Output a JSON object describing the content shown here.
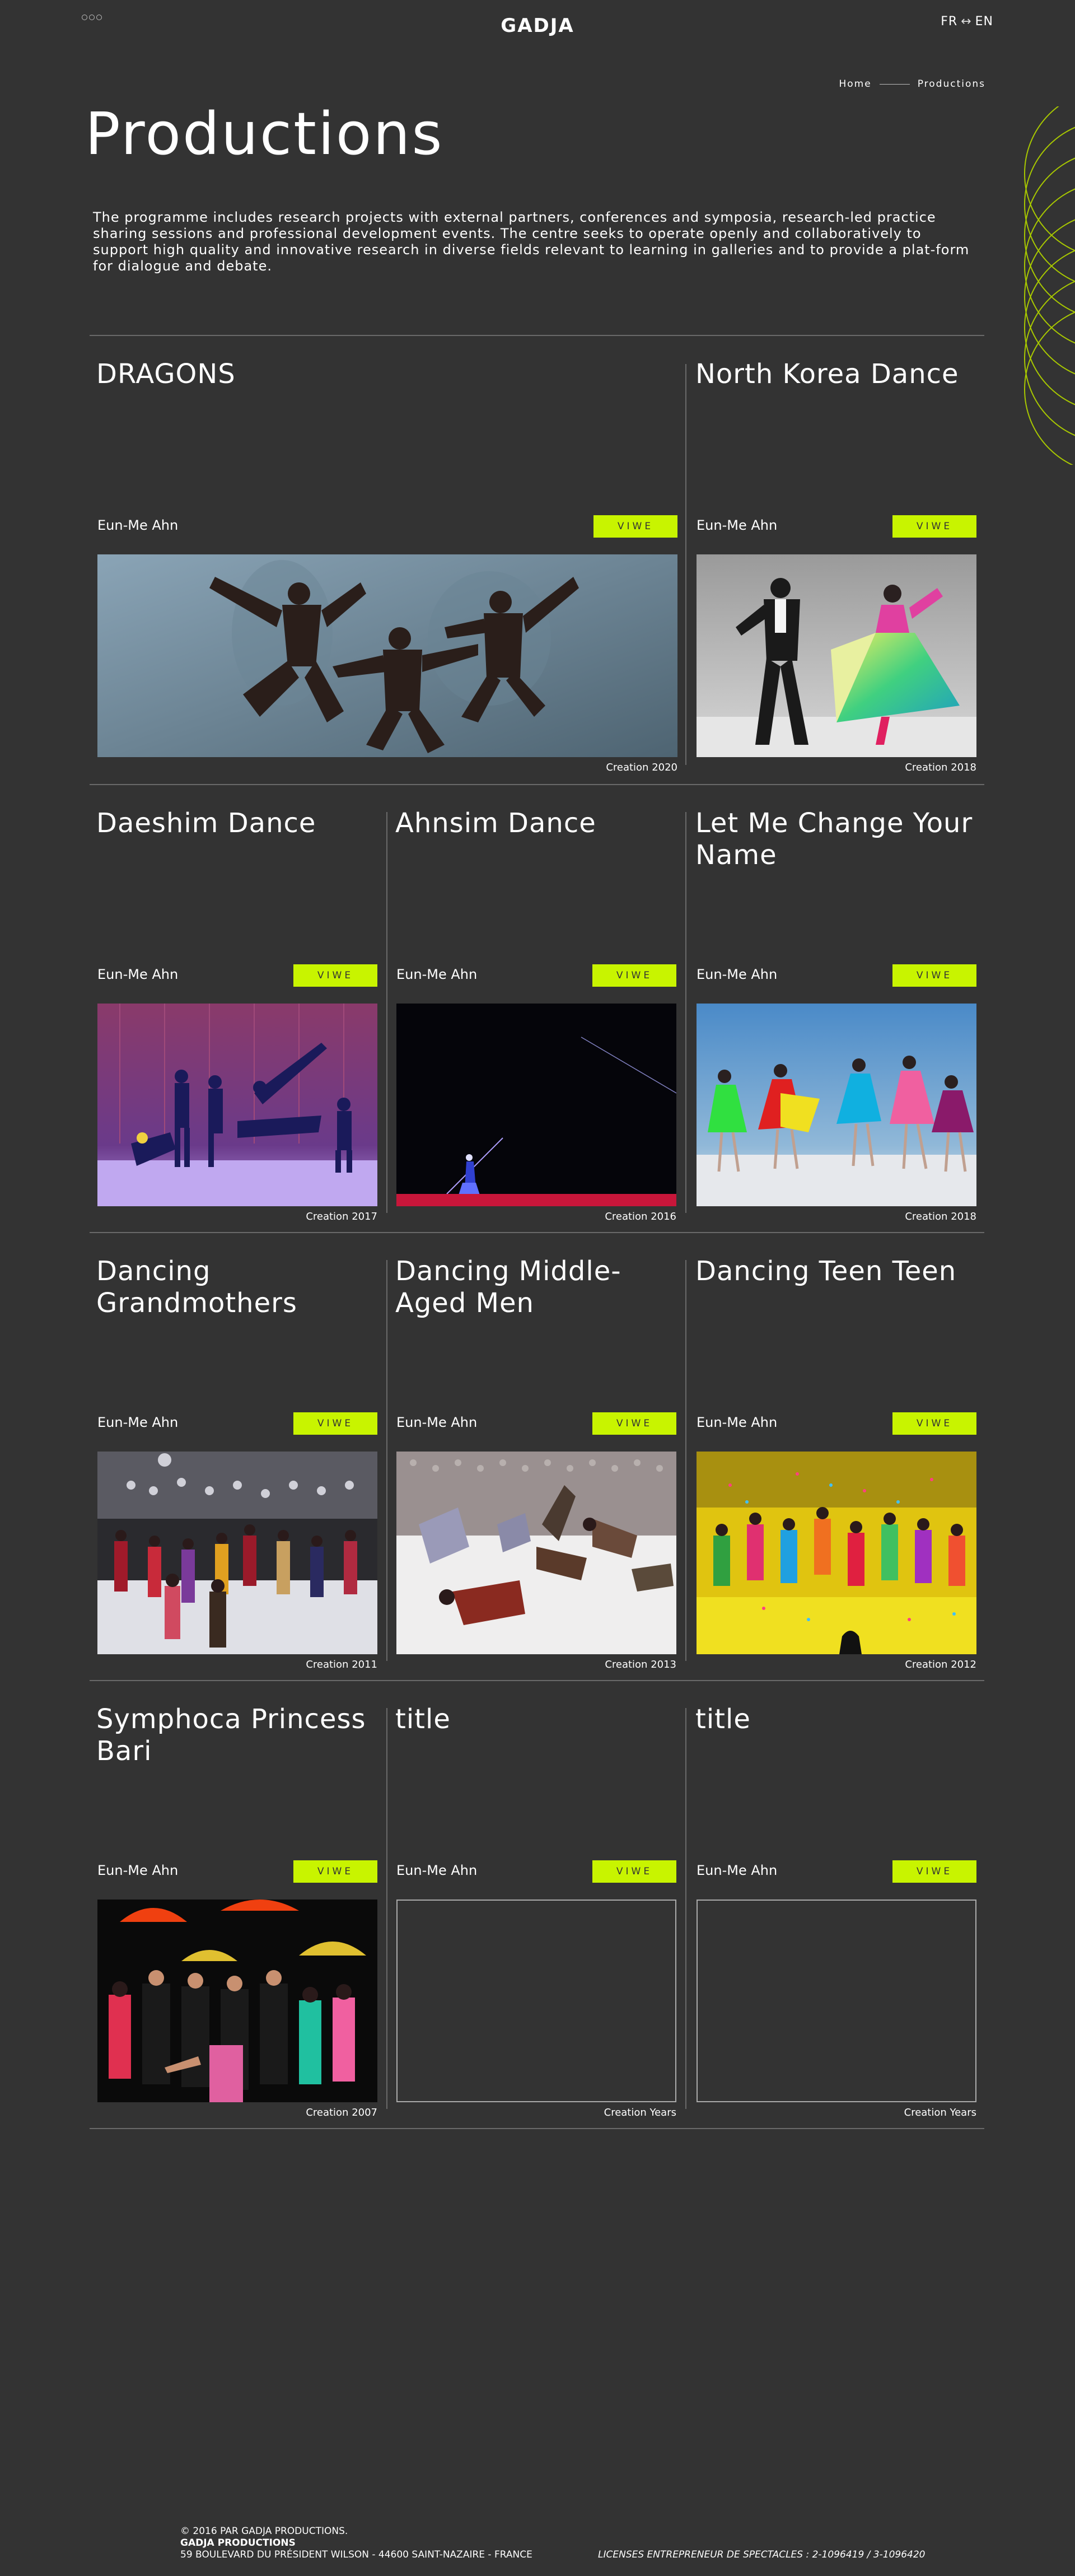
{
  "header": {
    "menu_icon": "menu-dots-icon",
    "logo": "GADJA",
    "lang_fr": "FR",
    "lang_sep": "↔",
    "lang_en": "EN"
  },
  "breadcrumb": {
    "home": "Home",
    "current": "Productions"
  },
  "page": {
    "title": "Productions",
    "intro": "The programme includes research projects with external partners, conferences and symposia, research-led practice sharing sessions and professional development events. The centre seeks to operate openly and collaboratively to support high quality and innovative research in diverse fields relevant to learning in galleries and to provide a plat-form for dialogue and debate."
  },
  "colors": {
    "background": "#333333",
    "accent": "#c8f400",
    "divider": "#6a6a6a",
    "deco_circles": "#a8c800"
  },
  "productions": [
    {
      "title": "DRAGONS",
      "author": "Eun-Me Ahn",
      "button": "VIWE",
      "year": "Creation 2020",
      "image": "dancers-leaping-photo"
    },
    {
      "title": "North Korea Dance",
      "author": "Eun-Me Ahn",
      "button": "VIWE",
      "year": "Creation 2018",
      "image": "duet-hanbok-photo"
    },
    {
      "title": "Daeshim Dance",
      "author": "Eun-Me Ahn",
      "button": "VIWE",
      "year": "Creation 2017",
      "image": "purple-stage-photo"
    },
    {
      "title": "Ahnsim Dance",
      "author": "Eun-Me Ahn",
      "button": "VIWE",
      "year": "Creation 2016",
      "image": "dark-stage-photo"
    },
    {
      "title": "Let Me Change Your Name",
      "author": "Eun-Me Ahn",
      "button": "VIWE",
      "year": "Creation 2018",
      "image": "colorful-dresses-photo"
    },
    {
      "title": "Dancing Grandmothers",
      "author": "Eun-Me Ahn",
      "button": "VIWE",
      "year": "Creation 2011",
      "image": "grandmothers-disco-photo"
    },
    {
      "title": "Dancing Middle-Aged Men",
      "author": "Eun-Me Ahn",
      "button": "VIWE",
      "year": "Creation 2013",
      "image": "men-floor-photo"
    },
    {
      "title": "Dancing Teen Teen",
      "author": "Eun-Me Ahn",
      "button": "VIWE",
      "year": "Creation 2012",
      "image": "yellow-confetti-photo"
    },
    {
      "title": "Symphoca Princess Bari",
      "author": "Eun-Me Ahn",
      "button": "VIWE",
      "year": "Creation 2007",
      "image": "umbrellas-ensemble-photo"
    },
    {
      "title": "title",
      "author": "Eun-Me Ahn",
      "button": "VIWE",
      "year": "Creation Years",
      "image": ""
    },
    {
      "title": "title",
      "author": "Eun-Me Ahn",
      "button": "VIWE",
      "year": "Creation Years",
      "image": ""
    }
  ],
  "footer": {
    "copyright": "© 2016 PAR GADJA PRODUCTIONS.",
    "company": "GADJA PRODUCTIONS",
    "address": "59 BOULEVARD DU PRÉSIDENT WILSON - 44600 SAINT-NAZAIRE - FRANCE",
    "license": "LICENSES ENTREPRENEUR DE SPECTACLES : 2-1096419 / 3-1096420"
  }
}
